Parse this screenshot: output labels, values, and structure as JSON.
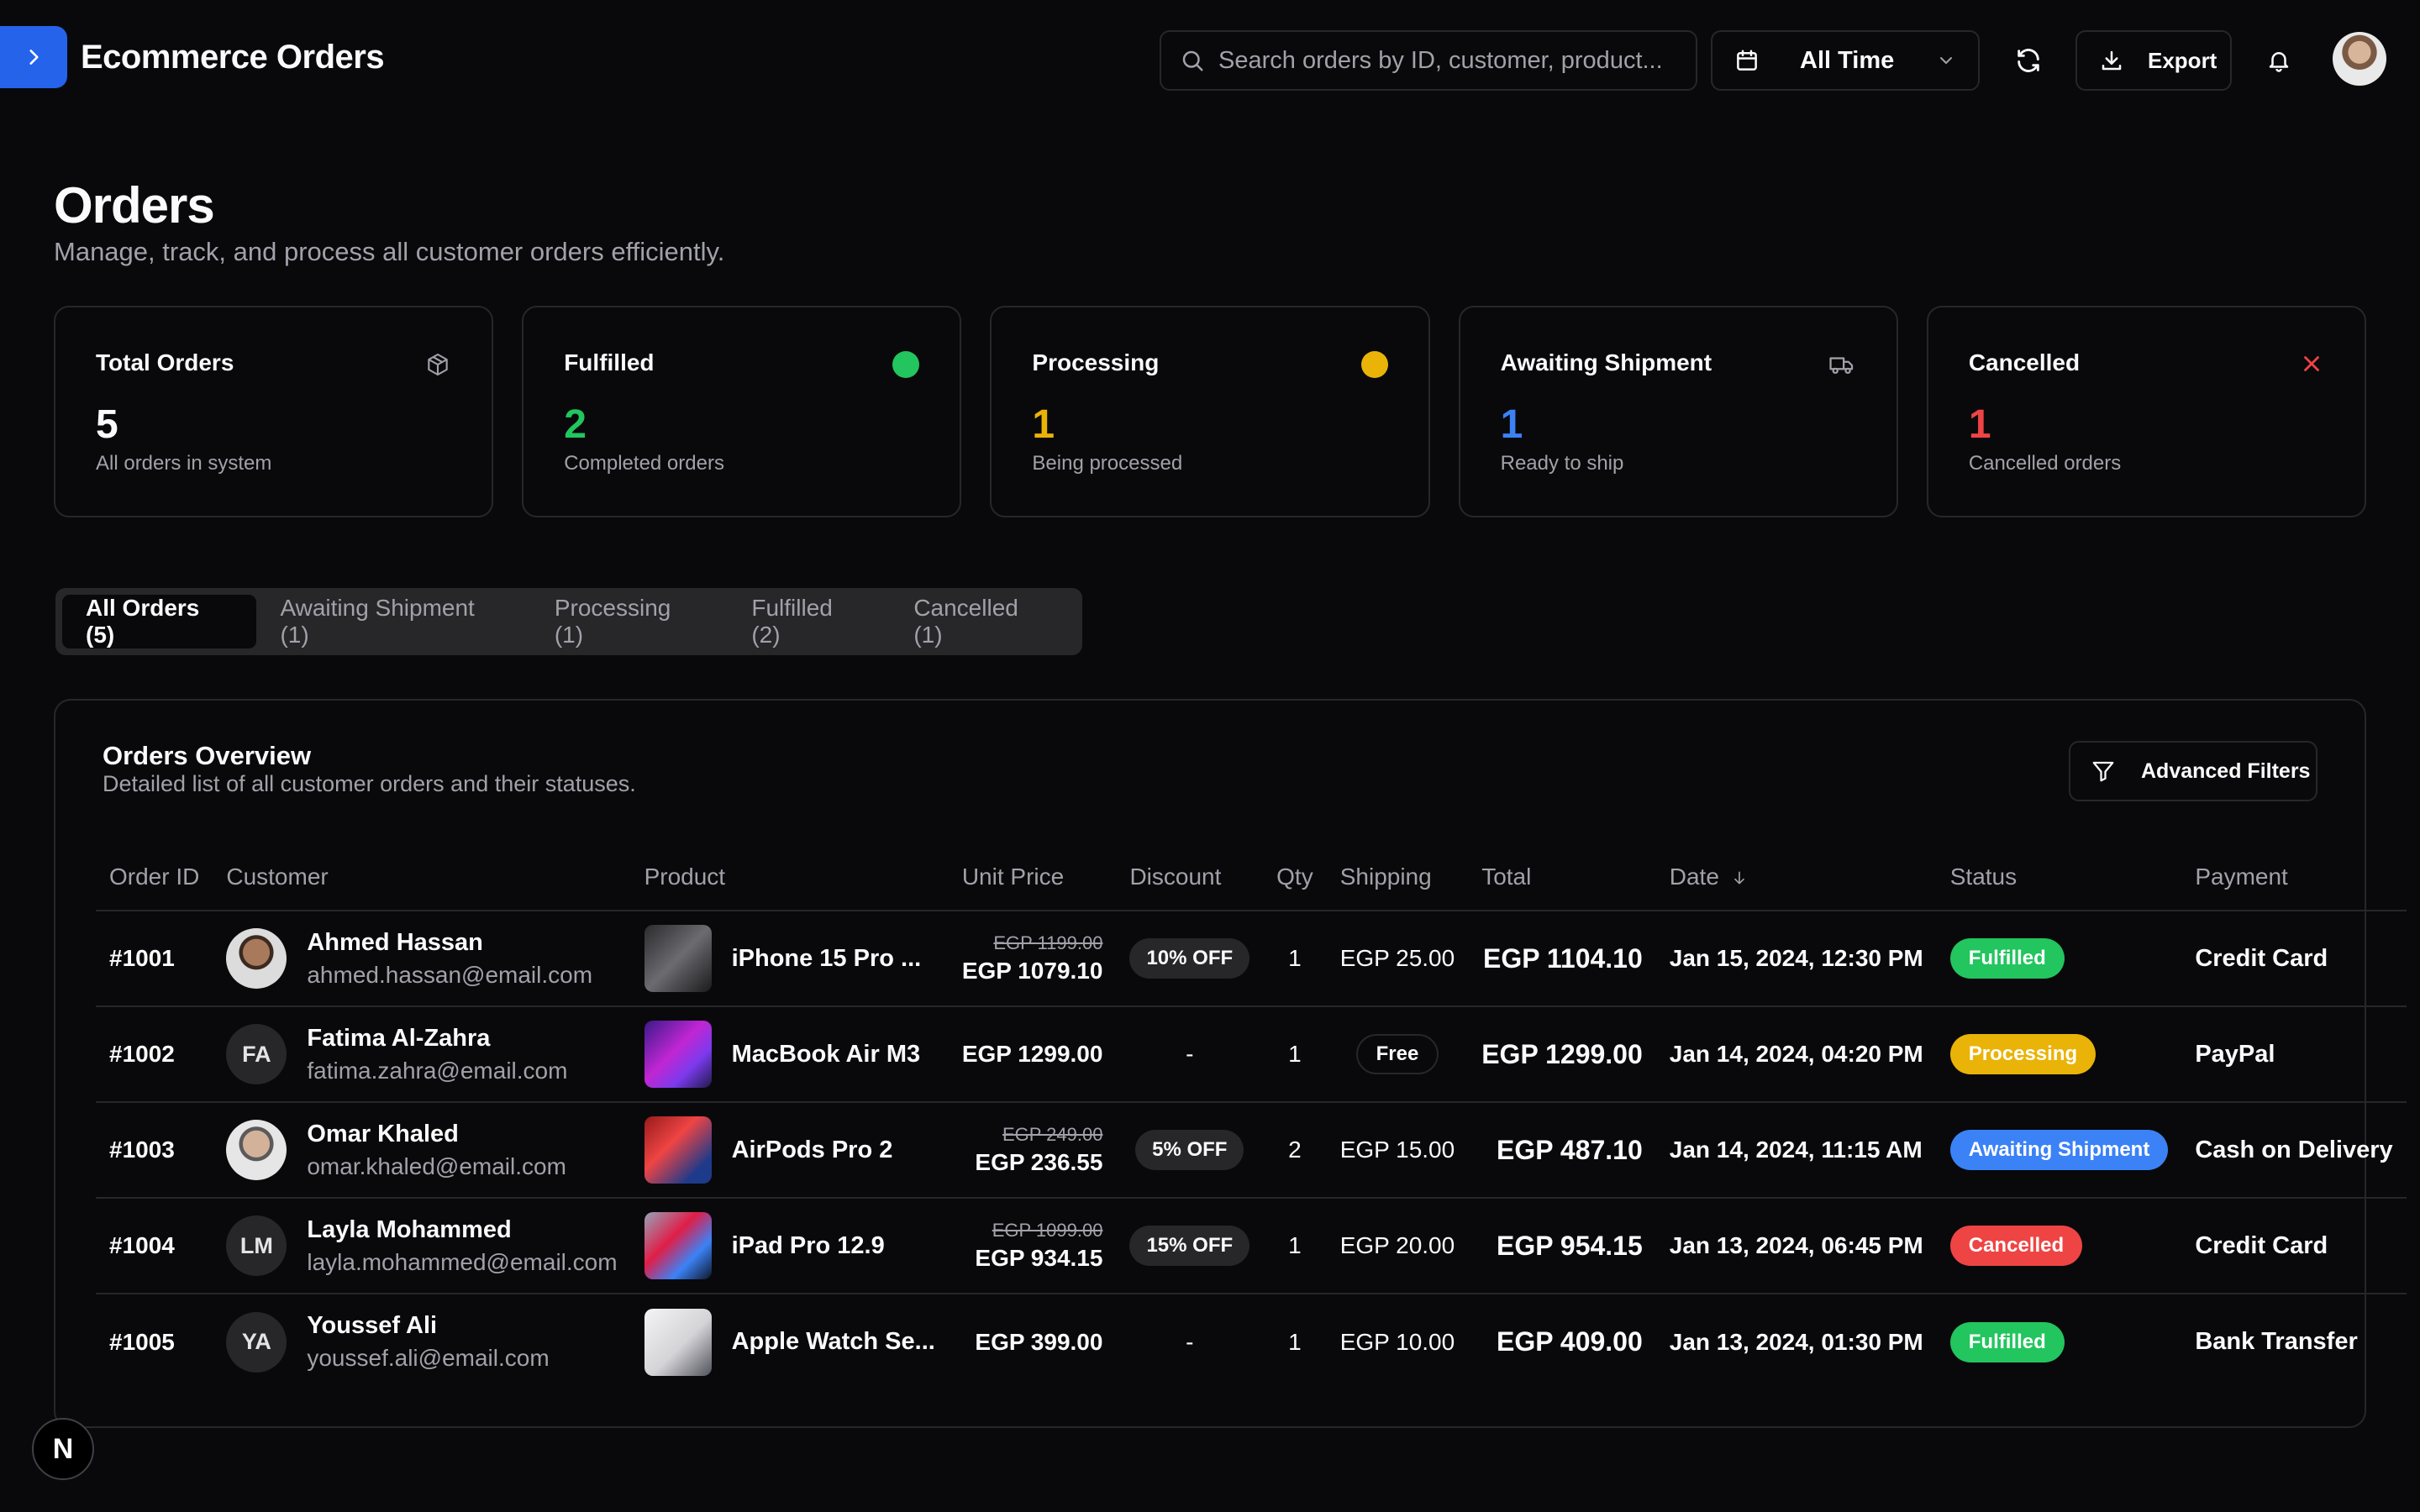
{
  "header": {
    "app_title": "Ecommerce Orders",
    "search_placeholder": "Search orders by ID, customer, product...",
    "date_range": "All Time",
    "export_label": "Export"
  },
  "page": {
    "title": "Orders",
    "subtitle": "Manage, track, and process all customer orders efficiently."
  },
  "stats": [
    {
      "title": "Total Orders",
      "value": "5",
      "desc": "All orders in system",
      "color": "#fafafa",
      "icon": "package-icon"
    },
    {
      "title": "Fulfilled",
      "value": "2",
      "desc": "Completed orders",
      "color": "#22c55e",
      "icon": "green-dot-icon"
    },
    {
      "title": "Processing",
      "value": "1",
      "desc": "Being processed",
      "color": "#eab308",
      "icon": "yellow-dot-icon"
    },
    {
      "title": "Awaiting Shipment",
      "value": "1",
      "desc": "Ready to ship",
      "color": "#3b82f6",
      "icon": "truck-icon"
    },
    {
      "title": "Cancelled",
      "value": "1",
      "desc": "Cancelled orders",
      "color": "#ef4444",
      "icon": "x-icon"
    }
  ],
  "tabs": [
    {
      "label": "All Orders (5)",
      "active": true
    },
    {
      "label": "Awaiting Shipment (1)",
      "active": false
    },
    {
      "label": "Processing (1)",
      "active": false
    },
    {
      "label": "Fulfilled (2)",
      "active": false
    },
    {
      "label": "Cancelled (1)",
      "active": false
    }
  ],
  "overview": {
    "title": "Orders Overview",
    "subtitle": "Detailed list of all customer orders and their statuses.",
    "filters_label": "Advanced Filters"
  },
  "table": {
    "columns": [
      "Order ID",
      "Customer",
      "Product",
      "Unit Price",
      "Discount",
      "Qty",
      "Shipping",
      "Total",
      "Date",
      "Status",
      "Payment"
    ],
    "rows": [
      {
        "id": "#1001",
        "avatar": "",
        "name": "Ahmed Hassan",
        "email": "ahmed.hassan@email.com",
        "product": "iPhone 15 Pro ...",
        "price_old": "EGP 1199.00",
        "price": "EGP 1079.10",
        "discount": "10% OFF",
        "qty": "1",
        "shipping": "EGP 25.00",
        "total": "EGP 1104.10",
        "date": "Jan 15, 2024, 12:30 PM",
        "status": "Fulfilled",
        "payment": "Credit Card"
      },
      {
        "id": "#1002",
        "avatar": "FA",
        "name": "Fatima Al-Zahra",
        "email": "fatima.zahra@email.com",
        "product": "MacBook Air M3",
        "price_old": "",
        "price": "EGP 1299.00",
        "discount": "-",
        "qty": "1",
        "shipping": "Free",
        "total": "EGP 1299.00",
        "date": "Jan 14, 2024, 04:20 PM",
        "status": "Processing",
        "payment": "PayPal"
      },
      {
        "id": "#1003",
        "avatar": "",
        "name": "Omar Khaled",
        "email": "omar.khaled@email.com",
        "product": "AirPods Pro 2",
        "price_old": "EGP 249.00",
        "price": "EGP 236.55",
        "discount": "5% OFF",
        "qty": "2",
        "shipping": "EGP 15.00",
        "total": "EGP 487.10",
        "date": "Jan 14, 2024, 11:15 AM",
        "status": "Awaiting Shipment",
        "payment": "Cash on Delivery"
      },
      {
        "id": "#1004",
        "avatar": "LM",
        "name": "Layla Mohammed",
        "email": "layla.mohammed@email.com",
        "product": "iPad Pro 12.9",
        "price_old": "EGP 1099.00",
        "price": "EGP 934.15",
        "discount": "15% OFF",
        "qty": "1",
        "shipping": "EGP 20.00",
        "total": "EGP 954.15",
        "date": "Jan 13, 2024, 06:45 PM",
        "status": "Cancelled",
        "payment": "Credit Card"
      },
      {
        "id": "#1005",
        "avatar": "YA",
        "name": "Youssef Ali",
        "email": "youssef.ali@email.com",
        "product": "Apple Watch Se...",
        "price_old": "",
        "price": "EGP 399.00",
        "discount": "-",
        "qty": "1",
        "shipping": "EGP 10.00",
        "total": "EGP 409.00",
        "date": "Jan 13, 2024, 01:30 PM",
        "status": "Fulfilled",
        "payment": "Bank Transfer"
      }
    ]
  },
  "status_colors": {
    "Fulfilled": "#22c55e",
    "Processing": "#eab308",
    "Awaiting Shipment": "#3b82f6",
    "Cancelled": "#ef4444"
  },
  "badge_letter": "N"
}
